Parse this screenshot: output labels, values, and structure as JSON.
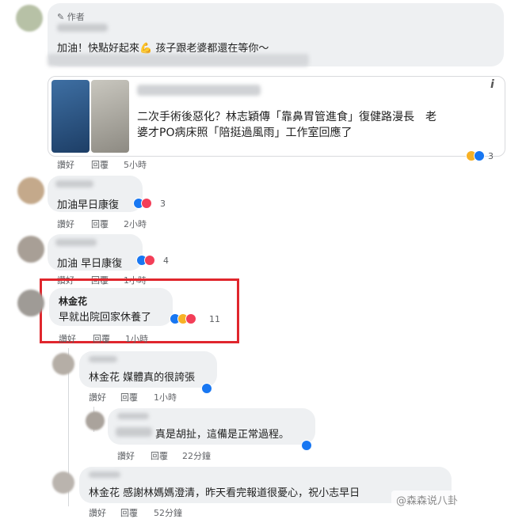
{
  "post_comment": {
    "author_badge": "作者",
    "text": "加油！快點好起來💪 孩子跟老婆都還在等你～",
    "link_card": {
      "headline_line1": "二次手術後惡化？林志穎傳「靠鼻胃管進食」復健路漫長　老",
      "headline_line2": "婆才PO病床照「陪挺過風雨」工作室回應了",
      "info_icon": "i",
      "reaction_count": "3"
    },
    "actions": {
      "like": "讚好",
      "reply": "回覆",
      "time": "5小時"
    }
  },
  "comments": [
    {
      "text": "加油早日康復",
      "reaction_count": "3",
      "like": "讚好",
      "reply": "回覆",
      "time": "2小時"
    },
    {
      "text": "加油 早日康復",
      "reaction_count": "4",
      "like": "讚好",
      "reply": "回覆",
      "time": "1小時"
    },
    {
      "name": "林金花",
      "text": "早就出院回家休養了",
      "reaction_count": "11",
      "like": "讚好",
      "reply": "回覆",
      "time": "1小時"
    }
  ],
  "replies": [
    {
      "mention": "林金花",
      "text": "媒體真的很誇張",
      "like": "讚好",
      "reply": "回覆",
      "time": "1小時"
    },
    {
      "text": "真是胡扯，這備是正常過程。",
      "like": "讚好",
      "reply": "回覆",
      "time": "22分鐘"
    },
    {
      "mention": "林金花",
      "text": "感謝林媽媽澄清，昨天看完報道很憂心，祝小志早日",
      "like": "讚好",
      "reply": "回覆",
      "time": "52分鐘"
    }
  ],
  "watermark": "@森森说八卦",
  "colors": {
    "highlight_box": "#e0262d",
    "like": "#1877f2",
    "heart": "#f33e58",
    "care": "#f7b125"
  }
}
